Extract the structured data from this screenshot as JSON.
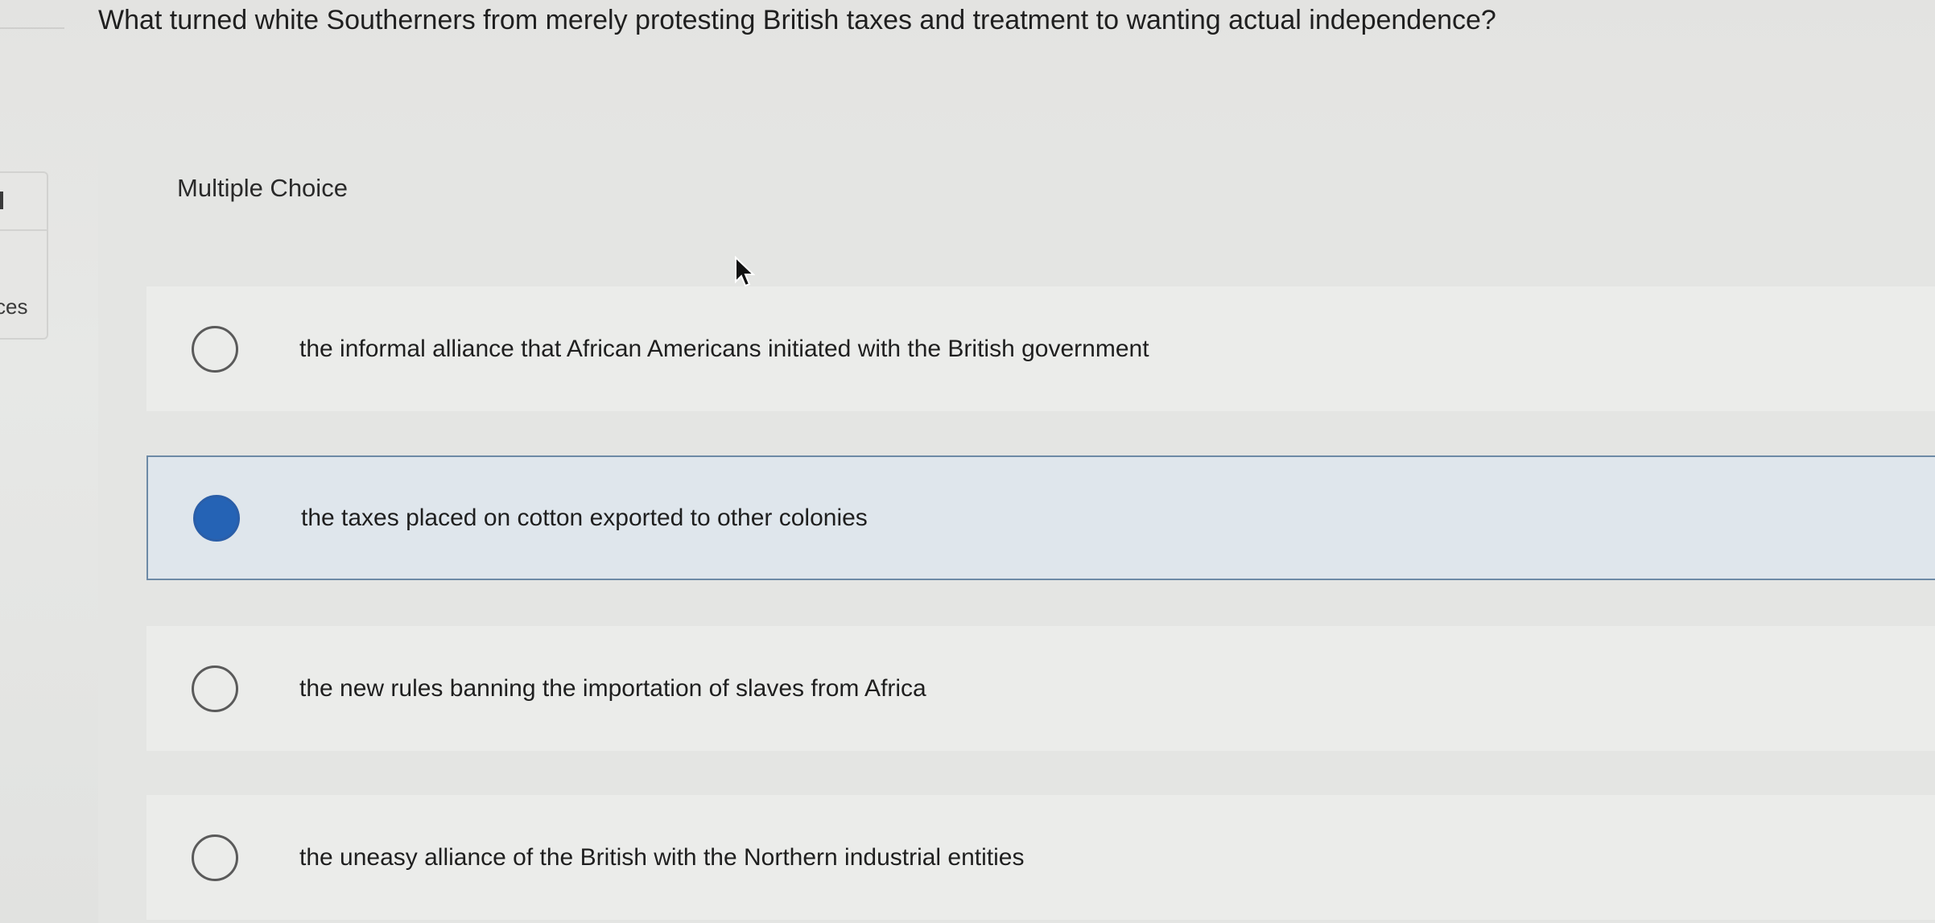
{
  "sidebar": {
    "text_fragment": "ces"
  },
  "question": {
    "text": "What turned white Southerners from merely protesting British taxes and treatment to wanting actual independence?"
  },
  "section": {
    "label": "Multiple Choice"
  },
  "options": [
    {
      "text": "the informal alliance that African Americans initiated with the British government",
      "selected": false
    },
    {
      "text": "the taxes placed on cotton exported to other colonies",
      "selected": true
    },
    {
      "text": "the new rules banning the importation of slaves from Africa",
      "selected": false
    },
    {
      "text": "the uneasy alliance of the British with the Northern industrial entities",
      "selected": false
    }
  ],
  "colors": {
    "selected_fill": "#2563b5",
    "selected_border": "#6d8aa6",
    "selected_background": "#dfe6ec"
  },
  "icons": {
    "cursor": "mouse-pointer-icon",
    "radio_empty": "radio-unchecked-icon",
    "radio_filled": "radio-checked-icon"
  }
}
